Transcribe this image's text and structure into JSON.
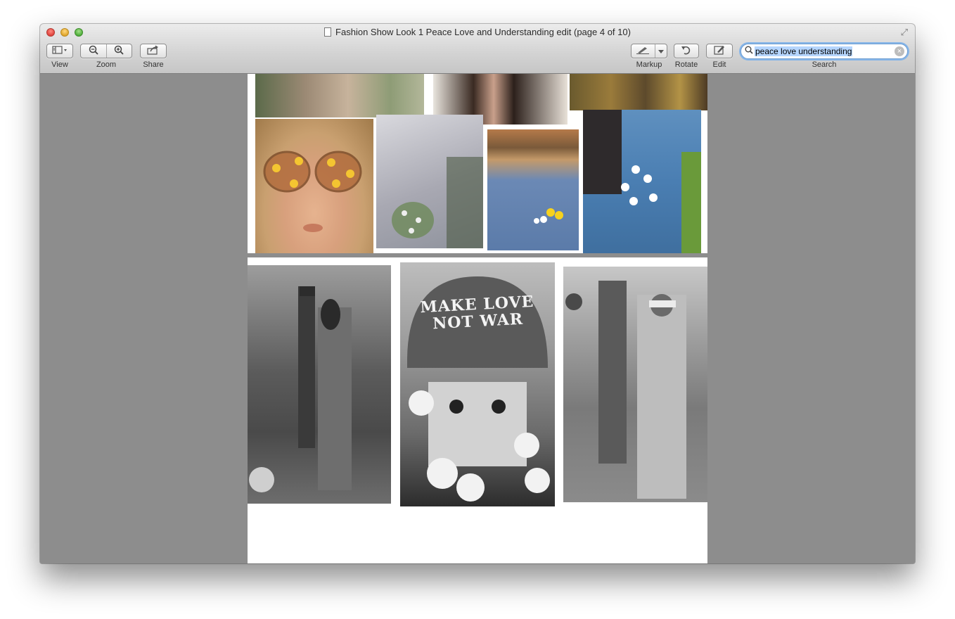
{
  "window": {
    "title": "Fashion Show Look 1 Peace Love and Understanding edit (page 4 of 10)"
  },
  "toolbar": {
    "view_label": "View",
    "zoom_label": "Zoom",
    "share_label": "Share",
    "markup_label": "Markup",
    "rotate_label": "Rotate",
    "edit_label": "Edit",
    "search_label": "Search"
  },
  "search": {
    "value": "peace love understanding"
  },
  "page_b": {
    "poster_text": "MAKE LOVE NOT WAR"
  },
  "colors": {
    "viewer_bg": "#8d8d8d",
    "search_focus": "#86b5e8",
    "selection": "#b5d5fd"
  },
  "icons": [
    "sidebar-view-icon",
    "zoom-out-icon",
    "zoom-in-icon",
    "share-icon",
    "markup-pen-icon",
    "rotate-icon",
    "edit-icon",
    "search-icon",
    "clear-icon",
    "fullscreen-icon",
    "document-icon"
  ]
}
